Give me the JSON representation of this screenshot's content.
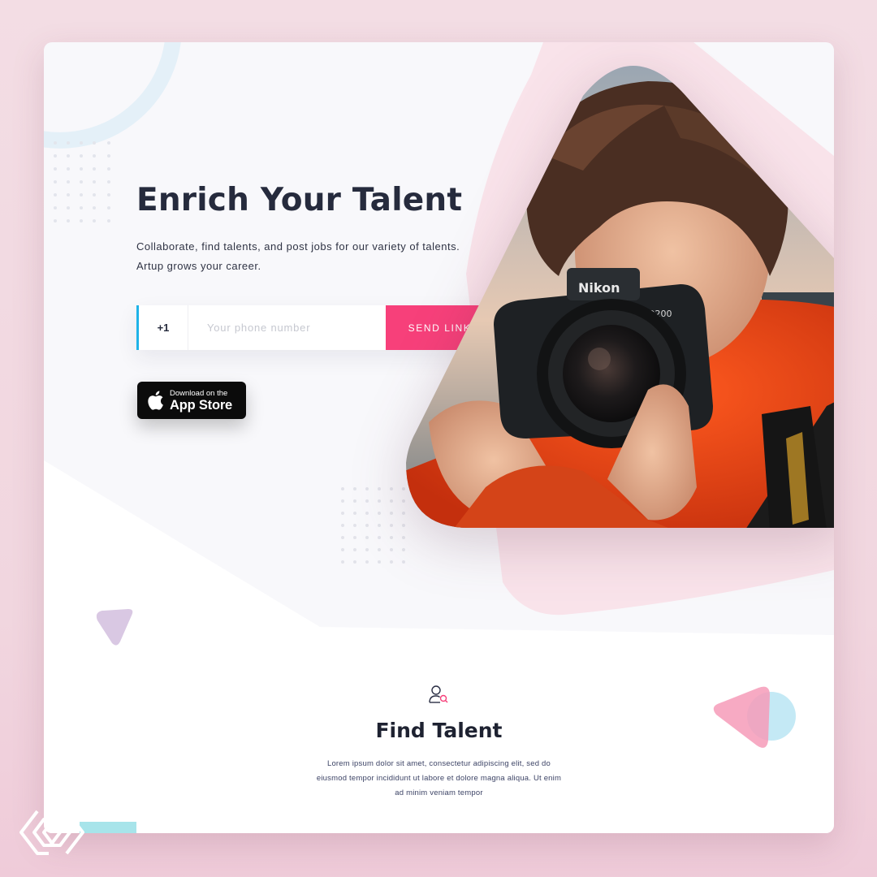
{
  "hero": {
    "title": "Enrich Your Talent",
    "subtitle": "Collaborate, find talents, and post jobs for our variety of talents. Artup grows your career."
  },
  "phone_form": {
    "country_code": "+1",
    "placeholder": "Your phone number",
    "value": "",
    "send_label": "SEND LINK"
  },
  "app_store": {
    "line1": "Download on the",
    "line2": "App Store"
  },
  "find_talent": {
    "title": "Find Talent",
    "body": "Lorem ipsum dolor sit amet, consectetur adipiscing elit, sed do eiusmod tempor incididunt ut labore et dolore magna aliqua. Ut enim ad minim veniam  tempor"
  },
  "photo": {
    "camera_brand": "Nikon",
    "camera_model": "D200"
  },
  "colors": {
    "accent_pink": "#f7407a",
    "accent_blue": "#1fb3e8",
    "title_dark": "#262b3d",
    "card_bg": "#f8f8fb",
    "page_bg": "#f3dde4"
  },
  "icons": [
    "apple-icon",
    "user-search-icon",
    "brand-logo"
  ]
}
